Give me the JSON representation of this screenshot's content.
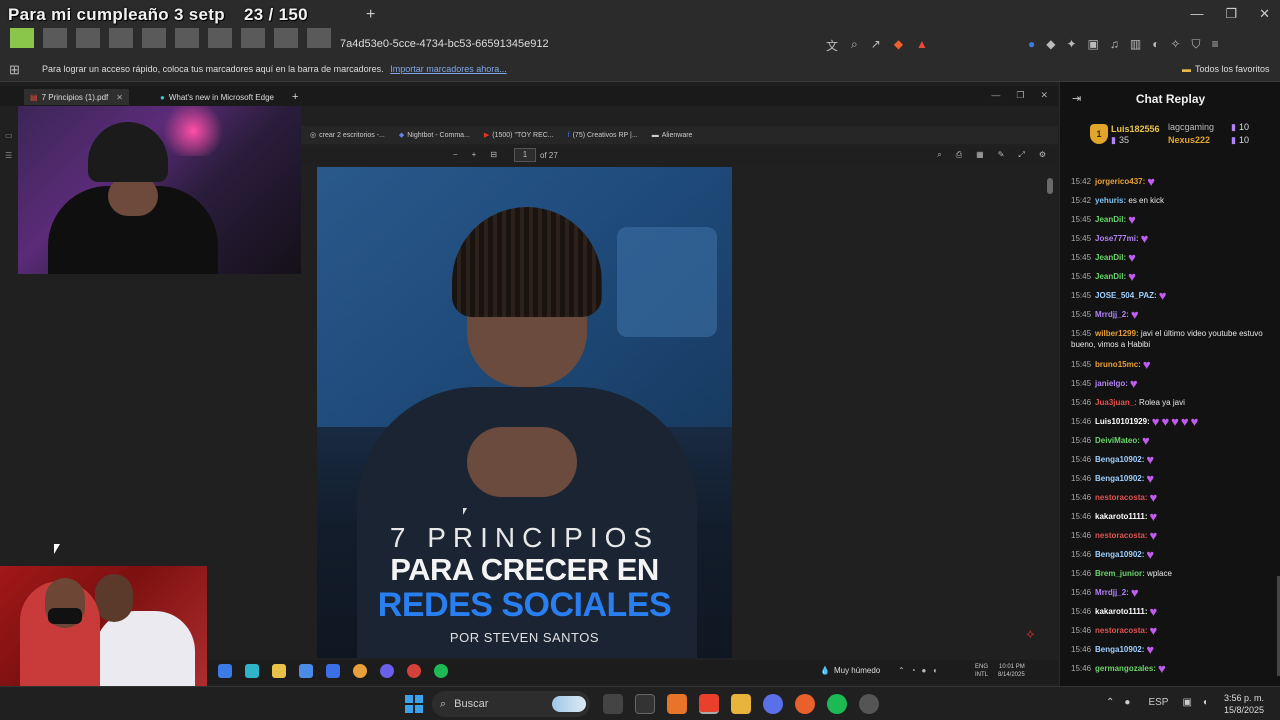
{
  "overlay": {
    "goal_text": "Para mi cumpleaño 3 setp",
    "goal_count": "23 / 150"
  },
  "browser": {
    "new_tab": "+",
    "url": "7a4d53e0-5cce-4734-bc53-66591345e912",
    "win_controls": [
      "—",
      "❐",
      "✕"
    ],
    "bookmarks_message": "Para lograr un acceso rápido, coloca tus marcadores aquí en la barra de marcadores.",
    "bookmarks_link": "Importar marcadores ahora...",
    "all_favorites": "Todos los favoritos"
  },
  "inner_browser": {
    "tabs": [
      {
        "label": "7 Principios (1).pdf",
        "close": "✕"
      },
      {
        "label": "What's new in Microsoft Edge"
      }
    ],
    "new_tab": "+",
    "controls": [
      "—",
      "❐",
      "✕"
    ],
    "bookmarks": [
      "crear 2 escritorios -...",
      "Nightbot - Comma...",
      "(1500) \"TOY REC...",
      "(75) Creativos RP |...",
      "Alienware"
    ],
    "pdf_toolbar": {
      "zoom_out": "−",
      "zoom_in": "+",
      "page": "1",
      "of": "of 27"
    }
  },
  "pdf": {
    "line1": "7 PRINCIPIOS",
    "line2": "PARA CRECER EN",
    "line3": "REDES SOCIALES",
    "line4": "POR STEVEN SANTOS"
  },
  "inner_taskbar": {
    "weather": "Muy húmedo",
    "lang1": "ENG",
    "lang2": "INTL",
    "time": "10:01 PM",
    "date": "8/14/2025"
  },
  "taskbar": {
    "search_placeholder": "Buscar",
    "lang": "ESP",
    "time": "3:56 p. m.",
    "date": "15/8/2025"
  },
  "chat": {
    "title": "Chat Replay",
    "leader1": {
      "rank": "1",
      "name": "Luis182556",
      "points": "35"
    },
    "leader2": {
      "name": "lagcgaming",
      "points": "10"
    },
    "leader3": {
      "name": "Nexus222",
      "points": "10"
    },
    "messages": [
      {
        "time": "15:42",
        "user": "jorgerico437:",
        "text": "",
        "color": "#e8a03a",
        "emotes": 1
      },
      {
        "time": "15:42",
        "user": "yehuris:",
        "text": " es en kick",
        "color": "#7fc3f0",
        "emotes": 0
      },
      {
        "time": "15:45",
        "user": "JeanDil:",
        "text": "",
        "color": "#6ad46a",
        "emotes": 1
      },
      {
        "time": "15:45",
        "user": "Jose777mi:",
        "text": "",
        "color": "#b084f5",
        "emotes": 1
      },
      {
        "time": "15:45",
        "user": "JeanDil:",
        "text": "",
        "color": "#6ad46a",
        "emotes": 1
      },
      {
        "time": "15:45",
        "user": "JeanDil:",
        "text": "",
        "color": "#6ad46a",
        "emotes": 1
      },
      {
        "time": "15:45",
        "user": "JOSE_504_PAZ:",
        "text": "",
        "color": "#9fd0ff",
        "emotes": 1
      },
      {
        "time": "15:45",
        "user": "Mrrdjj_2:",
        "text": "",
        "color": "#b084f5",
        "emotes": 1
      },
      {
        "time": "15:45",
        "user": "wilber1299:",
        "text": " javi el último video youtube estuvo bueno, vimos a Habibi",
        "color": "#e8a03a",
        "emotes": 0
      },
      {
        "time": "15:45",
        "user": "bruno15mc:",
        "text": "",
        "color": "#e8a03a",
        "emotes": 1
      },
      {
        "time": "15:45",
        "user": "janielgo:",
        "text": "",
        "color": "#b084f5",
        "emotes": 1
      },
      {
        "time": "15:46",
        "user": "Jua3juan_:",
        "text": " Rolea ya javi",
        "color": "#e05252",
        "emotes": 0
      },
      {
        "time": "15:46",
        "user": "Luis10101929:",
        "text": "",
        "color": "#ffffff",
        "emotes": 5
      },
      {
        "time": "15:46",
        "user": "DeiviMateo:",
        "text": "",
        "color": "#6ad46a",
        "emotes": 1
      },
      {
        "time": "15:46",
        "user": "Benga10902:",
        "text": "",
        "color": "#9fd0ff",
        "emotes": 1
      },
      {
        "time": "15:46",
        "user": "Benga10902:",
        "text": "",
        "color": "#9fd0ff",
        "emotes": 1
      },
      {
        "time": "15:46",
        "user": "nestoracosta:",
        "text": "",
        "color": "#e05252",
        "emotes": 1
      },
      {
        "time": "15:46",
        "user": "kakaroto1111:",
        "text": "",
        "color": "#ffffff",
        "emotes": 1
      },
      {
        "time": "15:46",
        "user": "nestoracosta:",
        "text": "",
        "color": "#e05252",
        "emotes": 1
      },
      {
        "time": "15:46",
        "user": "Benga10902:",
        "text": "",
        "color": "#9fd0ff",
        "emotes": 1
      },
      {
        "time": "15:46",
        "user": "Brem_junior:",
        "text": " wplace",
        "color": "#6ad46a",
        "emotes": 0
      },
      {
        "time": "15:46",
        "user": "Mrrdjj_2:",
        "text": "",
        "color": "#b084f5",
        "emotes": 1
      },
      {
        "time": "15:46",
        "user": "kakaroto1111:",
        "text": "",
        "color": "#ffffff",
        "emotes": 1
      },
      {
        "time": "15:46",
        "user": "nestoracosta:",
        "text": "",
        "color": "#e05252",
        "emotes": 1
      },
      {
        "time": "15:46",
        "user": "Benga10902:",
        "text": "",
        "color": "#9fd0ff",
        "emotes": 1
      },
      {
        "time": "15:46",
        "user": "germangozales:",
        "text": "",
        "color": "#6ad46a",
        "emotes": 1
      }
    ]
  }
}
